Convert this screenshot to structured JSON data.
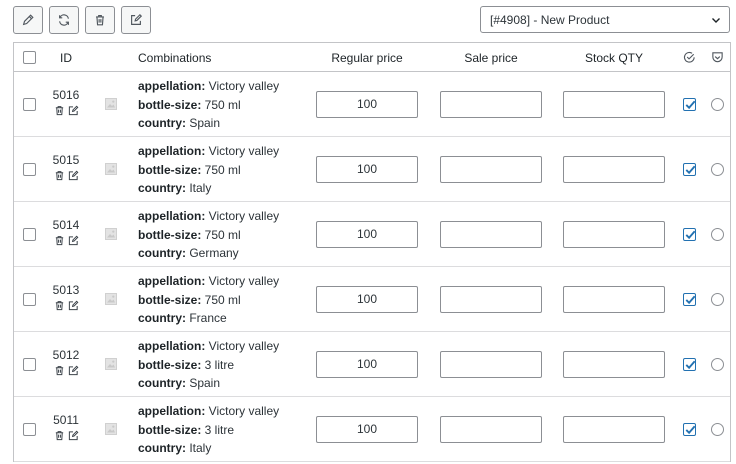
{
  "toolbar": {
    "buttons": [
      {
        "icon": "pencil-icon"
      },
      {
        "icon": "refresh-icon"
      },
      {
        "icon": "trash-icon"
      },
      {
        "icon": "edit-square-icon"
      }
    ]
  },
  "product_select": {
    "value": "[#4908] - New Product"
  },
  "table": {
    "headers": {
      "id": "ID",
      "combinations": "Combinations",
      "regular_price": "Regular price",
      "sale_price": "Sale price",
      "stock_qty": "Stock QTY"
    },
    "rows": [
      {
        "id": "5016",
        "attrs": [
          {
            "k": "appellation",
            "v": " Victory valley"
          },
          {
            "k": "bottle-size",
            "v": " 750 ml"
          },
          {
            "k": "country",
            "v": " Spain"
          }
        ],
        "regular": "100",
        "sale": "",
        "stock": "",
        "enabled": true
      },
      {
        "id": "5015",
        "attrs": [
          {
            "k": "appellation",
            "v": " Victory valley"
          },
          {
            "k": "bottle-size",
            "v": " 750 ml"
          },
          {
            "k": "country",
            "v": " Italy"
          }
        ],
        "regular": "100",
        "sale": "",
        "stock": "",
        "enabled": true
      },
      {
        "id": "5014",
        "attrs": [
          {
            "k": "appellation",
            "v": " Victory valley"
          },
          {
            "k": "bottle-size",
            "v": " 750 ml"
          },
          {
            "k": "country",
            "v": " Germany"
          }
        ],
        "regular": "100",
        "sale": "",
        "stock": "",
        "enabled": true
      },
      {
        "id": "5013",
        "attrs": [
          {
            "k": "appellation",
            "v": " Victory valley"
          },
          {
            "k": "bottle-size",
            "v": " 750 ml"
          },
          {
            "k": "country",
            "v": " France"
          }
        ],
        "regular": "100",
        "sale": "",
        "stock": "",
        "enabled": true
      },
      {
        "id": "5012",
        "attrs": [
          {
            "k": "appellation",
            "v": " Victory valley"
          },
          {
            "k": "bottle-size",
            "v": " 3 litre"
          },
          {
            "k": "country",
            "v": " Spain"
          }
        ],
        "regular": "100",
        "sale": "",
        "stock": "",
        "enabled": true
      },
      {
        "id": "5011",
        "attrs": [
          {
            "k": "appellation",
            "v": " Victory valley"
          },
          {
            "k": "bottle-size",
            "v": " 3 litre"
          },
          {
            "k": "country",
            "v": " Italy"
          }
        ],
        "regular": "100",
        "sale": "",
        "stock": "",
        "enabled": true
      }
    ]
  },
  "colors": {
    "accent": "#2271b1",
    "border": "#8c8f94",
    "divider": "#dcdcde"
  }
}
